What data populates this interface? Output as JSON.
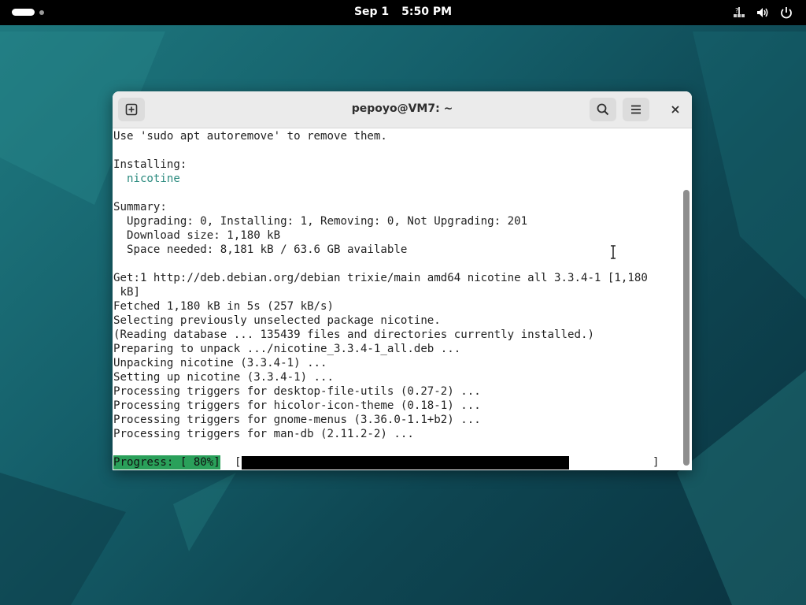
{
  "topbar": {
    "date": "Sep 1",
    "time": "5:50 PM",
    "icons": [
      "network-icon",
      "volume-icon",
      "power-icon"
    ]
  },
  "window": {
    "title": "pepoyo@VM7: ~",
    "buttons": [
      "new-tab-icon",
      "search-icon",
      "menu-icon",
      "close-icon"
    ]
  },
  "terminal": {
    "lines": [
      "Use 'sudo apt autoremove' to remove them.",
      "",
      "Installing:",
      "  nicotine",
      "",
      "Summary:",
      "  Upgrading: 0, Installing: 1, Removing: 0, Not Upgrading: 201",
      "  Download size: 1,180 kB",
      "  Space needed: 8,181 kB / 63.6 GB available",
      "",
      "Get:1 http://deb.debian.org/debian trixie/main amd64 nicotine all 3.3.4-1 [1,180",
      " kB]",
      "Fetched 1,180 kB in 5s (257 kB/s)",
      "Selecting previously unselected package nicotine.",
      "(Reading database ... 135439 files and directories currently installed.)",
      "Preparing to unpack .../nicotine_3.3.4-1_all.deb ...",
      "Unpacking nicotine (3.3.4-1) ...",
      "Setting up nicotine (3.3.4-1) ...",
      "Processing triggers for desktop-file-utils (0.27-2) ...",
      "Processing triggers for hicolor-icon-theme (0.18-1) ...",
      "Processing triggers for gnome-menus (3.36.0-1.1+b2) ...",
      "Processing triggers for man-db (2.11.2-2) ..."
    ],
    "progress_label": "Progress: [ 80%]",
    "progress_open": "[",
    "progress_close": "]",
    "progress_fraction": 0.8
  },
  "colors": {
    "package_name": "#2a8a7e",
    "progress_label_bg": "#2aa05a",
    "progress_bar": "#000000"
  }
}
